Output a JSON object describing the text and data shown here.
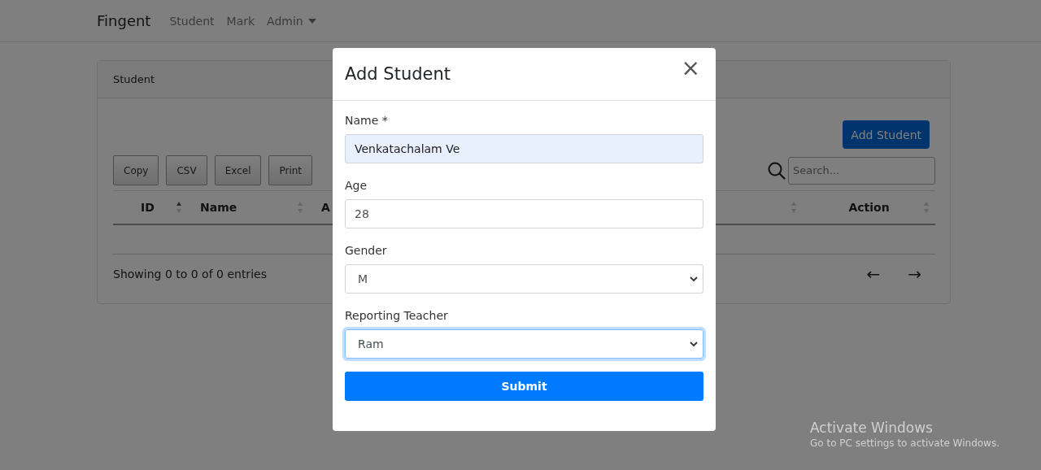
{
  "navbar": {
    "brand": "Fingent",
    "items": [
      {
        "label": "Student",
        "dropdown": false
      },
      {
        "label": "Mark",
        "dropdown": false
      },
      {
        "label": "Admin",
        "dropdown": true
      }
    ]
  },
  "card": {
    "title": "Student",
    "add_button": "Add Student",
    "export_buttons": [
      "Copy",
      "CSV",
      "Excel",
      "Print"
    ],
    "search": {
      "placeholder": "Search..."
    },
    "table": {
      "columns": [
        {
          "label": "ID",
          "sorted": true
        },
        {
          "label": "Name",
          "sorted": false
        },
        {
          "label": "A"
        },
        {
          "sorted": false
        },
        {
          "label": "Action",
          "sorted": false
        }
      ]
    },
    "info": "Showing 0 to 0 of 0 entries",
    "pagination": {
      "prev": "←",
      "next": "→"
    }
  },
  "modal": {
    "title": "Add Student",
    "close": "×",
    "fields": [
      {
        "label": "Name *",
        "kind": "text",
        "value": "Venkatachalam Ve",
        "autofilled": true,
        "focused": false
      },
      {
        "label": "Age",
        "kind": "text",
        "value": "28",
        "autofilled": false,
        "focused": false
      },
      {
        "label": "Gender",
        "kind": "select",
        "value": "M",
        "autofilled": false,
        "focused": false
      },
      {
        "label": "Reporting Teacher",
        "kind": "select",
        "value": "Ram",
        "autofilled": false,
        "focused": true
      }
    ],
    "submit": "Submit"
  },
  "os_notice": {
    "title": "Activate Windows",
    "text": "Go to PC settings to activate Windows."
  }
}
